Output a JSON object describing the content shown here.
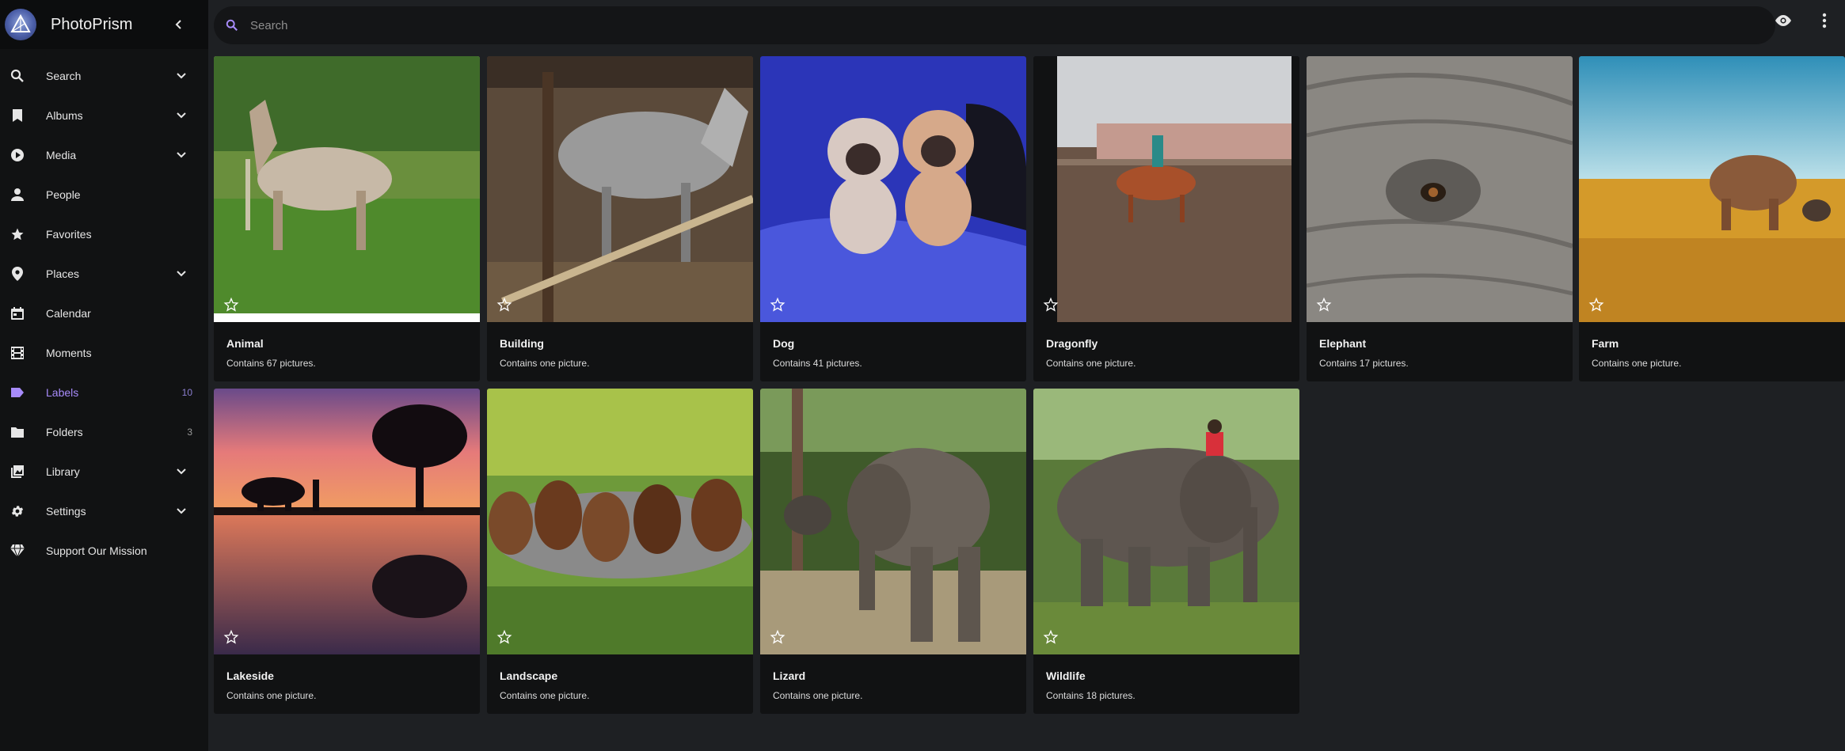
{
  "app": {
    "title": "PhotoPrism"
  },
  "search": {
    "placeholder": "Search"
  },
  "sidebar": {
    "items": [
      {
        "label": "Search",
        "icon": "search-icon",
        "expandable": true
      },
      {
        "label": "Albums",
        "icon": "bookmark-icon",
        "expandable": true
      },
      {
        "label": "Media",
        "icon": "play-circle-icon",
        "expandable": true
      },
      {
        "label": "People",
        "icon": "person-icon",
        "expandable": false
      },
      {
        "label": "Favorites",
        "icon": "star-icon",
        "expandable": false
      },
      {
        "label": "Places",
        "icon": "map-pin-icon",
        "expandable": true
      },
      {
        "label": "Calendar",
        "icon": "calendar-icon",
        "expandable": false
      },
      {
        "label": "Moments",
        "icon": "film-icon",
        "expandable": false
      },
      {
        "label": "Labels",
        "icon": "label-icon",
        "count": "10",
        "active": true
      },
      {
        "label": "Folders",
        "icon": "folder-icon",
        "count": "3"
      },
      {
        "label": "Library",
        "icon": "library-icon",
        "expandable": true
      },
      {
        "label": "Settings",
        "icon": "gear-icon",
        "expandable": true
      },
      {
        "label": "Support Our Mission",
        "icon": "diamond-icon",
        "expandable": false
      }
    ]
  },
  "labels": [
    {
      "title": "Animal",
      "subtitle": "Contains 67 pictures."
    },
    {
      "title": "Building",
      "subtitle": "Contains one picture."
    },
    {
      "title": "Dog",
      "subtitle": "Contains 41 pictures."
    },
    {
      "title": "Dragonfly",
      "subtitle": "Contains one picture."
    },
    {
      "title": "Elephant",
      "subtitle": "Contains 17 pictures."
    },
    {
      "title": "Farm",
      "subtitle": "Contains one picture."
    },
    {
      "title": "Lakeside",
      "subtitle": "Contains one picture."
    },
    {
      "title": "Landscape",
      "subtitle": "Contains one picture."
    },
    {
      "title": "Lizard",
      "subtitle": "Contains one picture."
    },
    {
      "title": "Wildlife",
      "subtitle": "Contains 18 pictures."
    }
  ],
  "colors": {
    "accent": "#a78bfa",
    "background": "#1e2023",
    "sidebar": "#111213"
  }
}
